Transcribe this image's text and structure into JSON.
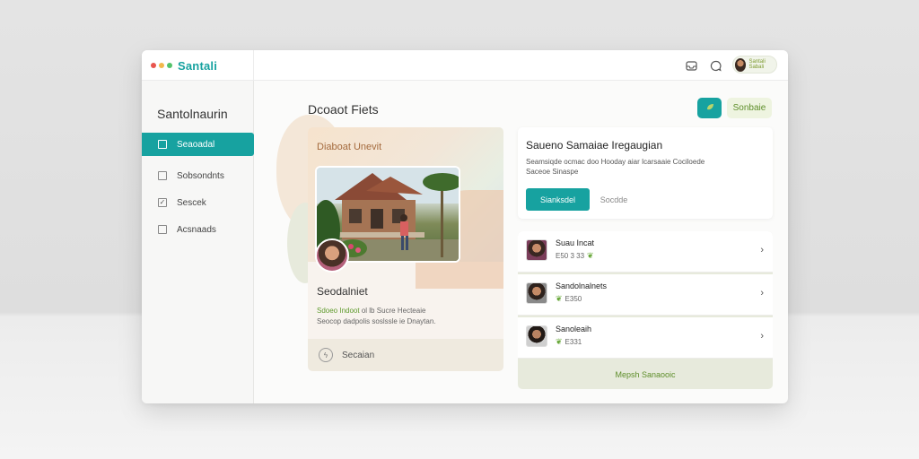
{
  "app": {
    "brand": "Santali",
    "colors": {
      "accent": "#17a2a0",
      "leaf_green": "#68a83a",
      "dot_red": "#e8554e",
      "dot_yellow": "#f2b84b",
      "dot_green": "#53c26a"
    }
  },
  "topbar": {
    "icons": [
      "inbox-icon",
      "chat-icon"
    ],
    "avatar_label": "Santali Sabali"
  },
  "sidebar": {
    "title": "Santolnaurin",
    "items": [
      {
        "label": "Seaoadal",
        "active": true,
        "checked": false
      },
      {
        "label": "Sobsondnts",
        "active": false,
        "checked": false
      },
      {
        "label": "Sescek",
        "active": false,
        "checked": true
      },
      {
        "label": "Acsnaads",
        "active": false,
        "checked": false
      }
    ]
  },
  "main": {
    "title": "Dcoaot Fiets",
    "header_action_label": "Sonbaie"
  },
  "feature": {
    "hero_label": "Diaboat Unevit",
    "name": "Seodalniet",
    "sub_line_1_green": "Sdoeo Indoot",
    "sub_line_1_rest": " ol lb Sucre Hecteaie",
    "sub_line_2": "Seocop dadpolis soslssle ie Dnaytan.",
    "footer_label": "Secaian"
  },
  "info_card": {
    "title": "Saueno Samaiae Iregaugian",
    "desc_line_1": "Seamsiqde ocmac doo Hooday aiar Icarsaaie Cociloede",
    "desc_line_2": "Saceoe Sinaspe",
    "primary_button": "Sianksdel",
    "secondary_button": "Socdde"
  },
  "people": [
    {
      "name": "Suau Incat",
      "meta": "E50 3 33"
    },
    {
      "name": "Sandolnalnets",
      "meta": "E350"
    },
    {
      "name": "Sanoleaih",
      "meta": "E331"
    }
  ],
  "list_footer": "Mepsh Sanaooic"
}
